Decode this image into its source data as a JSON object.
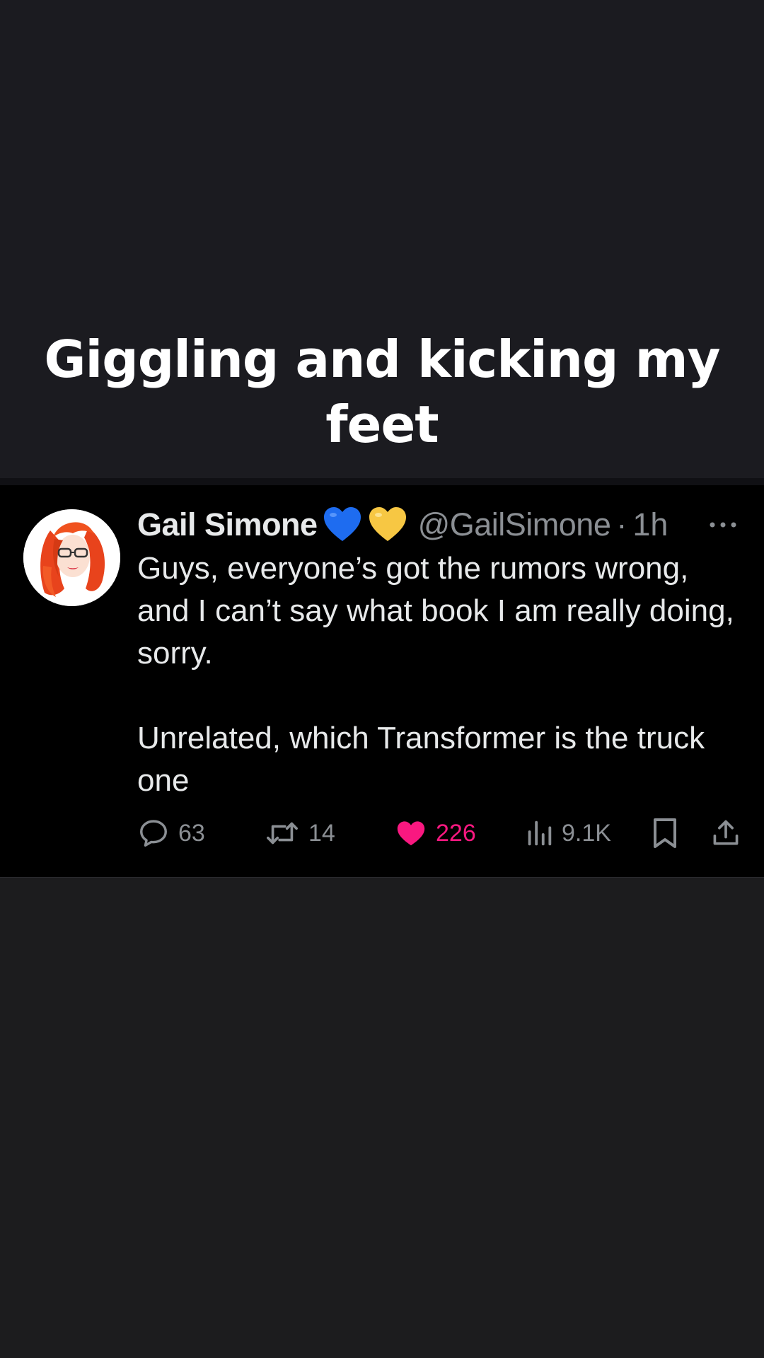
{
  "caption": {
    "line1": "Giggling and kicking my",
    "line2": "feet"
  },
  "tweet": {
    "display_name": "Gail Simone",
    "emojis": [
      "blue-heart-emoji",
      "yellow-heart-emoji"
    ],
    "handle": "@GailSimone",
    "separator": "·",
    "time": "1h",
    "text": "Guys, everyone’s got the rumors wrong, and I can’t say what book I am really doing, sorry.\n\nUnrelated, which Transformer is the truck one",
    "actions": {
      "replies": "63",
      "retweets": "14",
      "likes": "226",
      "views": "9.1K"
    }
  },
  "colors": {
    "background_top": "#1b1b20",
    "card_background": "#000000",
    "text_primary": "#e7e9ea",
    "text_secondary": "#8b8f94",
    "like_pink": "#f91880",
    "blue_heart": "#1e6cf0",
    "yellow_heart": "#f7c743"
  }
}
